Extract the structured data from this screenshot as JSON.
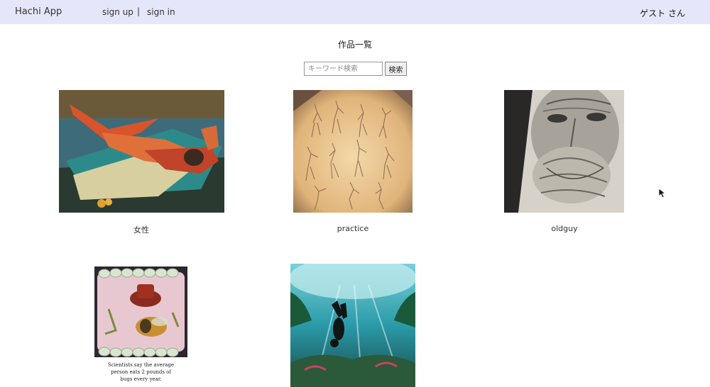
{
  "header": {
    "brand": "Hachi App",
    "signup": "sign up",
    "separator": "|",
    "signin": "sign in",
    "user": "ゲスト さん"
  },
  "page": {
    "title": "作品一覧"
  },
  "search": {
    "placeholder": "キーワード検索",
    "button": "検索"
  },
  "works": [
    {
      "title": "女性",
      "icon": "painting-reclining-woman"
    },
    {
      "title": "practice",
      "icon": "figure-sketches"
    },
    {
      "title": "oldguy",
      "icon": "pencil-portrait-old-man"
    },
    {
      "title": "",
      "icon": "illustration-bug-in-mouth",
      "caption": [
        "Scientists say the average",
        "person eats 2 pounds of",
        "bugs every year."
      ]
    },
    {
      "title": "",
      "icon": "underwater-diver"
    }
  ]
}
